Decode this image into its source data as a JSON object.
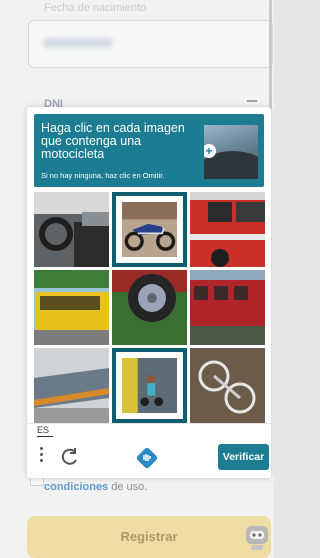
{
  "background": {
    "top_label": "Fecha de nacimiento",
    "id_type": "DNI",
    "terms_link": "condiciones",
    "terms_suffix": " de uso.",
    "register_label": "Registrar"
  },
  "captcha": {
    "title": "Haga clic en cada imagen que contenga una motocicleta",
    "subtitle": "Si no hay ninguna, haz clic en Omitir.",
    "language": "ES",
    "verify_label": "Verificar",
    "tiles": [
      {
        "name": "car-interior",
        "selected": false
      },
      {
        "name": "motorcycle",
        "selected": true
      },
      {
        "name": "red-truck",
        "selected": false
      },
      {
        "name": "yellow-bus",
        "selected": false
      },
      {
        "name": "tire-closeup",
        "selected": false
      },
      {
        "name": "red-train",
        "selected": false
      },
      {
        "name": "train-platform",
        "selected": false
      },
      {
        "name": "child-on-scooter",
        "selected": true
      },
      {
        "name": "bicycle-overhead",
        "selected": false
      }
    ],
    "colors": {
      "accent": "#1c7d92",
      "selected_border": "#0e5e70"
    }
  }
}
